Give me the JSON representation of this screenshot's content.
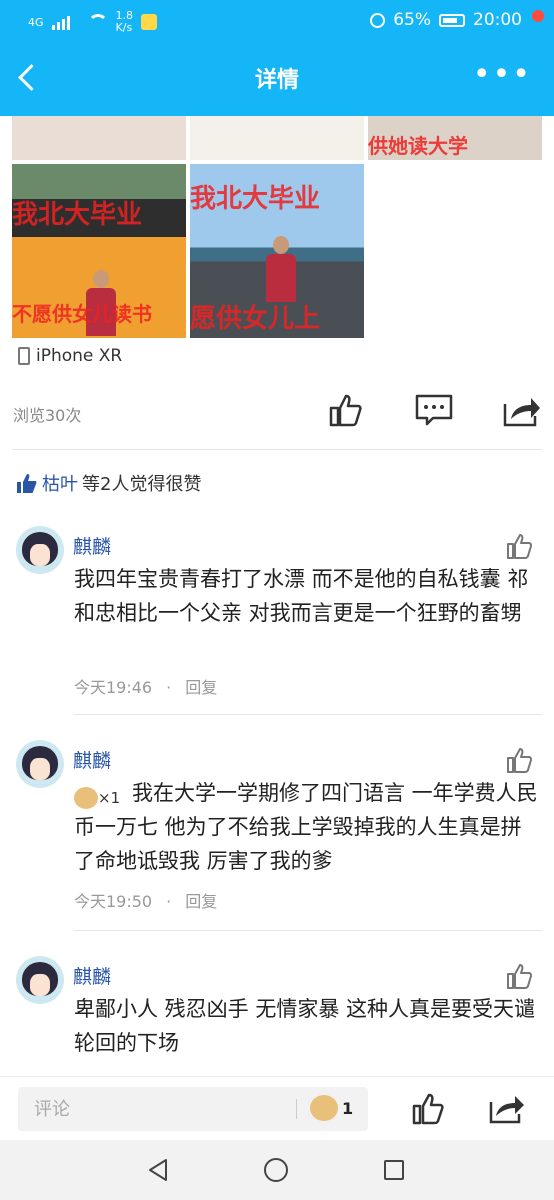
{
  "status_bar": {
    "network": "4G",
    "speed_value": "1.8",
    "speed_unit": "K/s",
    "battery_percent": "65%",
    "time": "20:00"
  },
  "header": {
    "title": "详情"
  },
  "post": {
    "photo_watermarks": [
      "我北大毕业",
      "不愿供女儿读书",
      "我北大毕业",
      "愿供女儿上"
    ],
    "top_watermark": "供她读大学",
    "device": "iPhone XR",
    "views": "浏览30次"
  },
  "likes": {
    "name": "枯叶",
    "suffix": "等2人觉得很赞"
  },
  "comments": [
    {
      "author": "麒麟",
      "text": "我四年宝贵青春打了水漂 而不是他的自私钱囊 祁和忠相比一个父亲 对我而言更是一个狂野的畜甥",
      "time": "今天19:46",
      "reply_label": "回复"
    },
    {
      "author": "麒麟",
      "badge": "×1",
      "text": "我在大学一学期修了四门语言 一年学费人民币一万七 他为了不给我上学毁掉我的人生真是拼了命地诋毁我 厉害了我的爹",
      "time": "今天19:50",
      "reply_label": "回复"
    },
    {
      "author": "麒麟",
      "text": "卑鄙小人 残忍凶手 无情家暴 这种人真是要受天谴 轮回的下场"
    }
  ],
  "bottom_bar": {
    "placeholder": "评论",
    "gift_count": "1"
  },
  "colors": {
    "accent": "#15b6f7",
    "link": "#2a56a8"
  }
}
